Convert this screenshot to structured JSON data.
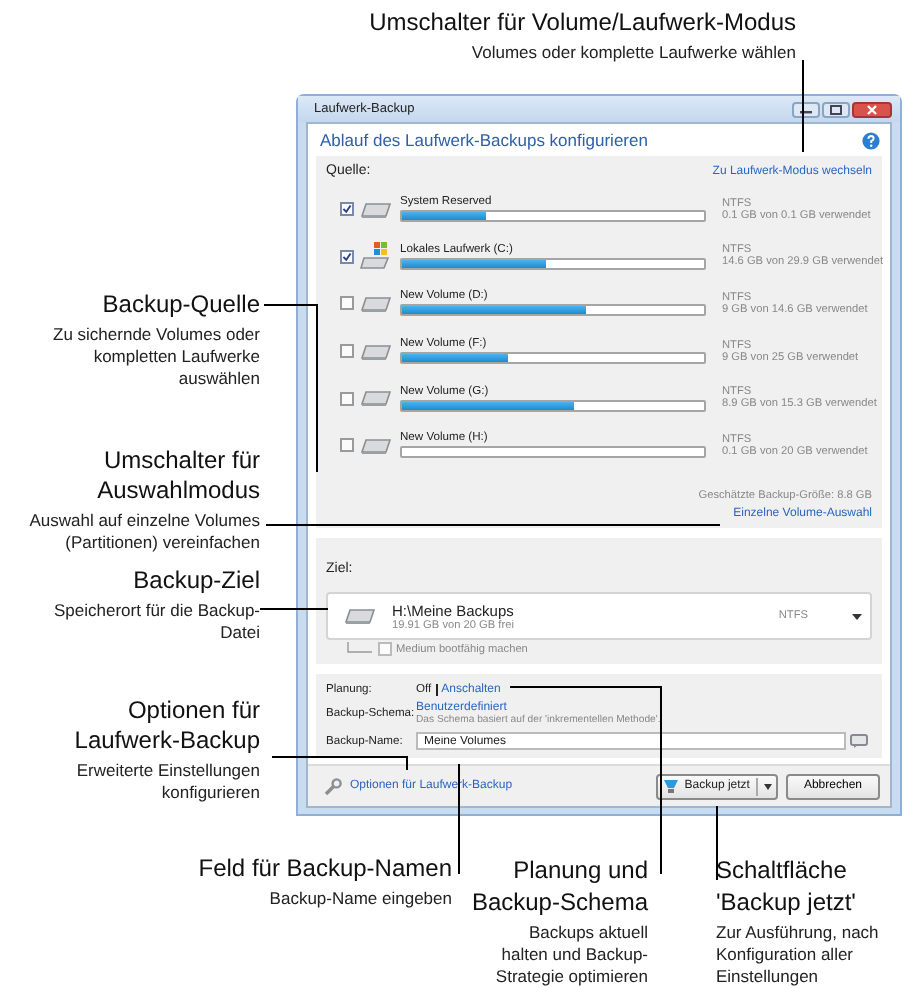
{
  "top_callout": {
    "title": "Umschalter für Volume/Laufwerk-Modus",
    "description": "Volumes oder komplette Laufwerke wählen"
  },
  "left_callouts": [
    {
      "title": "Backup-Quelle",
      "description": "Zu sichernde Volumes oder kompletten Laufwerke auswählen"
    },
    {
      "title": "Umschalter für Auswahlmodus",
      "description": "Auswahl auf einzelne Volumes (Partitionen) vereinfachen"
    },
    {
      "title": "Backup-Ziel",
      "description": "Speicherort für die Backup-Datei"
    },
    {
      "title": "Optionen für Laufwerk-Backup",
      "description": "Erweiterte Einstellungen konfigurieren"
    }
  ],
  "window": {
    "title": "Laufwerk-Backup",
    "heading": "Ablauf des Laufwerk-Backups konfigurieren",
    "source": {
      "label": "Quelle:",
      "mode_link": "Zu Laufwerk-Modus wechseln",
      "volumes": [
        {
          "kind": "drive",
          "name": "System Reserved",
          "checked": true,
          "level": 0.28,
          "filesystem": "NTFS",
          "usage": "0.1 GB von 0.1 GB verwendet"
        },
        {
          "kind": "system",
          "name": "Lokales Laufwerk (C:)",
          "checked": true,
          "level": 0.48,
          "filesystem": "NTFS",
          "usage": "14.6 GB von 29.9 GB verwendet"
        },
        {
          "kind": "drive",
          "name": "New Volume (D:)",
          "checked": false,
          "level": 0.61,
          "filesystem": "NTFS",
          "usage": "9 GB von 14.6 GB verwendet"
        },
        {
          "kind": "drive",
          "name": "New Volume (F:)",
          "checked": false,
          "level": 0.35,
          "filesystem": "NTFS",
          "usage": "9 GB von 25 GB verwendet"
        },
        {
          "kind": "drive",
          "name": "New Volume (G:)",
          "checked": false,
          "level": 0.57,
          "filesystem": "NTFS",
          "usage": "8.9 GB von 15.3 GB verwendet"
        },
        {
          "kind": "drive",
          "name": "New Volume (H:)",
          "checked": false,
          "level": 0,
          "filesystem": "NTFS",
          "usage": "0.1 GB von 20 GB verwendet"
        }
      ],
      "estimated_size": "Geschätzte Backup-Größe: 8.8 GB",
      "selection_link": "Einzelne Volume-Auswahl"
    },
    "target": {
      "label": "Ziel:",
      "path": "H:\\Meine Backups",
      "free": "19.91 GB von 20 GB frei",
      "filesystem": "NTFS",
      "bootable_label": "Medium bootfähig machen",
      "bootable_checked": false
    },
    "planning": {
      "schedule_label": "Planung:",
      "schedule_state": "Off",
      "schedule_link": "Anschalten",
      "scheme_label": "Backup-Schema:",
      "scheme_value": "Benutzerdefiniert",
      "scheme_note": "Das Schema basiert auf der 'inkrementellen Methode'.",
      "name_label": "Backup-Name:",
      "name_value": "Meine Volumes"
    },
    "footer": {
      "options_link": "Optionen für Laufwerk-Backup",
      "backup_button": "Backup jetzt",
      "cancel_button": "Abbrechen"
    }
  },
  "bottom_callouts": [
    {
      "title": "Feld für Backup-Namen",
      "description": "Backup-Name eingeben"
    },
    {
      "title": "Planung und Backup-Schema",
      "description": "Backups aktuell halten und Backup-Strategie optimieren"
    },
    {
      "title": "Schaltfläche 'Backup jetzt'",
      "description": "Zur Ausführung, nach Konfiguration aller Einstellungen"
    }
  ]
}
